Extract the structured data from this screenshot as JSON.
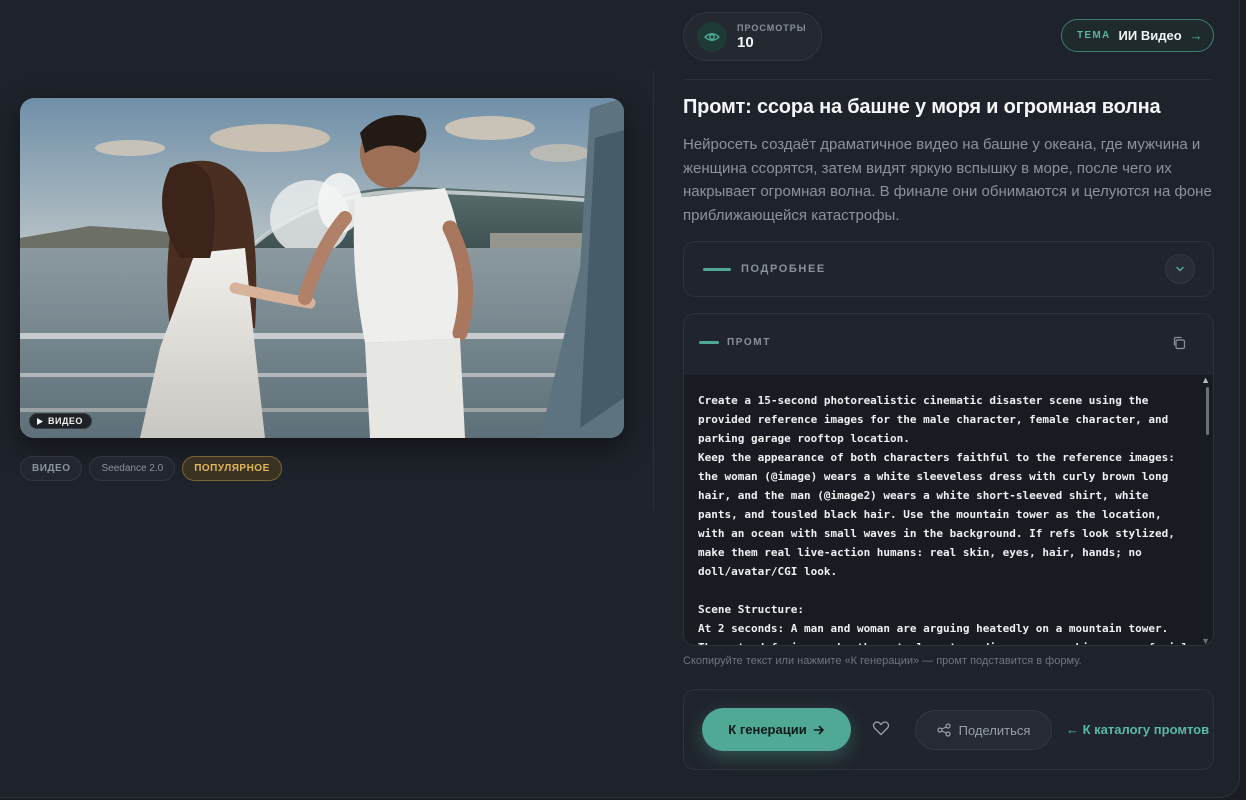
{
  "media": {
    "badge": "ВИДЕО"
  },
  "tags": [
    "ВИДЕО",
    "Seedance 2.0",
    "ПОПУЛЯРНОЕ"
  ],
  "views": {
    "label": "ПРОСМОТРЫ",
    "value": "10"
  },
  "theme": {
    "label": "ТЕМА",
    "value": "ИИ Видео",
    "arrow": "→"
  },
  "title": "Промт: ссора на башне у моря и огромная волна",
  "description": "Нейросеть создаёт драматичное видео на башне у океана, где мужчина и женщина ссорятся, затем видят яркую вспышку в море, после чего их накрывает огромная волна. В финале они обнимаются и целуются на фоне приближающейся катастрофы.",
  "details": {
    "label": "ПОДРОБНЕЕ"
  },
  "prompt": {
    "label": "ПРОМТ",
    "text": "Create a 15-second photorealistic cinematic disaster scene using the provided reference images for the male character, female character, and parking garage rooftop location.\nKeep the appearance of both characters faithful to the reference images: the woman (@image) wears a white sleeveless dress with curly brown long hair, and the man (@image2) wears a white short-sleeved shirt, white pants, and tousled black hair. Use the mountain tower as the location, with an ocean with small waves in the background. If refs look stylized, make them real live-action humans: real skin, eyes, hair, hands; no doll/avatar/CGI look.\n\nScene Structure:\nAt 2 seconds: A man and woman are arguing heatedly on a mountain tower. They stand facing each other at close to medium range, making angry facial expressions, sharp hand gestures, tense eye contact, and emotionally"
  },
  "hint": "Скопируйте текст или нажмите «К генерации» — промт подставится в форму.",
  "actions": {
    "generate": "К генерации",
    "share": "Поделиться",
    "catalog": "← К каталогу промтов"
  },
  "colors": {
    "accent": "#4fa995",
    "gold": "#e3b65a",
    "background": "#1e222a"
  },
  "icons": [
    "eye-icon",
    "arrow-right-icon",
    "chevron-down-icon",
    "copy-icon",
    "heart-icon",
    "share-icon",
    "play-icon"
  ]
}
